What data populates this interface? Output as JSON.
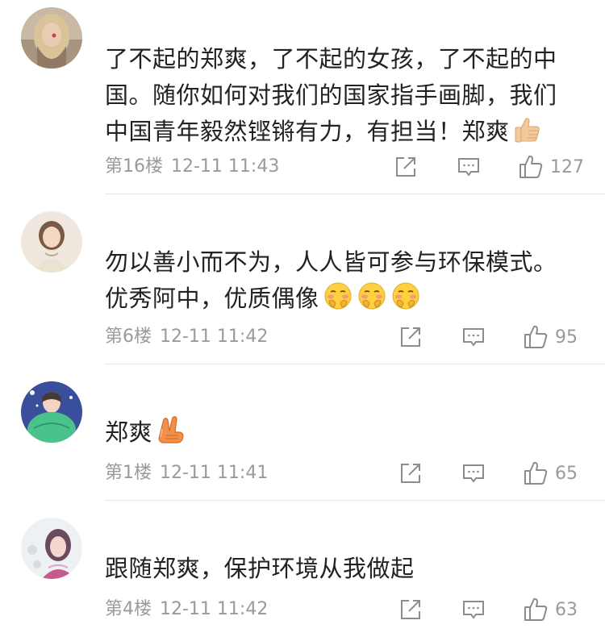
{
  "comments": [
    {
      "text_lines": [
        "了不起的郑爽，了不起的女孩，了不起的中",
        "国。随你如何对我们的国家指手画脚，我们",
        "中国青年毅然铿锵有力，有担当！郑爽"
      ],
      "emojis": [
        "thumbs-up-emoji"
      ],
      "floor": "第16楼",
      "time": "12-11 11:43",
      "likes": "127"
    },
    {
      "text_lines": [
        "勿以善小而不为，人人皆可参与环保模式。",
        "优秀阿中，优质偶像"
      ],
      "emojis": [
        "blush-face-emoji",
        "blush-face-emoji",
        "blush-face-emoji"
      ],
      "floor": "第6楼",
      "time": "12-11 11:42",
      "likes": "95"
    },
    {
      "text_lines": [
        "郑爽"
      ],
      "emojis": [
        "victory-hand-emoji"
      ],
      "floor": "第1楼",
      "time": "12-11 11:41",
      "likes": "65"
    },
    {
      "text_lines": [
        "跟随郑爽，保护环境从我做起"
      ],
      "emojis": [],
      "floor": "第4楼",
      "time": "12-11 11:42",
      "likes": "63"
    }
  ],
  "colors": {
    "text": "#222222",
    "meta": "#9a9a9a",
    "divider": "#e6e6e6",
    "icon": "#8c8c8c"
  }
}
